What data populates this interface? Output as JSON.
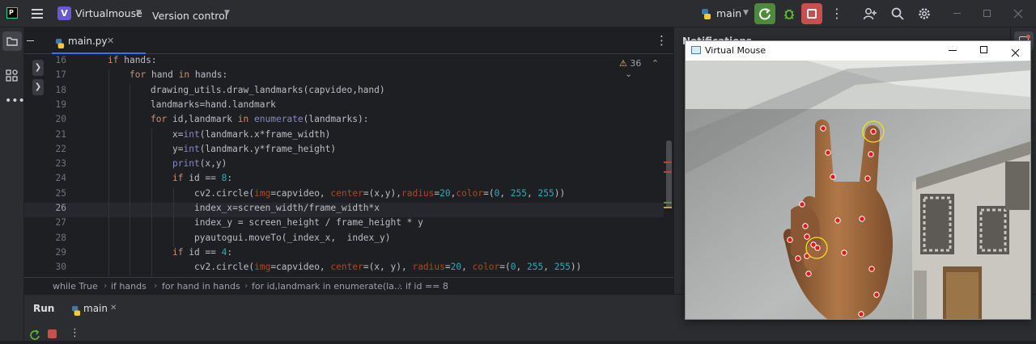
{
  "titlebar": {
    "project_badge": "V",
    "project_name": "Virtualmouse",
    "vcs_label": "Version control",
    "run_config": "main",
    "colors": {
      "badge": "#6b57d2",
      "rerun": "#4e8a3e",
      "stop": "#c94f4f"
    }
  },
  "editor": {
    "tab_label": "main.py",
    "warnings_count": "36",
    "lines": [
      {
        "n": "16",
        "code": "if hands:"
      },
      {
        "n": "17",
        "code": "for hand in hands:"
      },
      {
        "n": "18",
        "code": "drawing_utils.draw_landmarks(capvideo,hand)"
      },
      {
        "n": "19",
        "code": "landmarks=hand.landmark"
      },
      {
        "n": "20",
        "code": "for id,landmark in enumerate(landmarks):"
      },
      {
        "n": "21",
        "code": "x=int(landmark.x*frame_width)"
      },
      {
        "n": "22",
        "code": "y=int(landmark.y*frame_height)"
      },
      {
        "n": "23",
        "code": "print(x,y)"
      },
      {
        "n": "24",
        "code": "if id == 8:"
      },
      {
        "n": "25",
        "code": "cv2.circle(img=capvideo, center=(x,y),radius=20,color=(0, 255, 255))"
      },
      {
        "n": "26",
        "code": "index_x=screen_width/frame_width*x"
      },
      {
        "n": "27",
        "code": "index_y = screen_height / frame_height * y"
      },
      {
        "n": "28",
        "code": "pyautogui.moveTo(_index_x,  index_y)"
      },
      {
        "n": "29",
        "code": "if id == 4:"
      },
      {
        "n": "30",
        "code": "cv2.circle(img=capvideo, center=(x, y), radius=20, color=(0, 255, 255))"
      }
    ],
    "breadcrumb": [
      "while True",
      "if hands",
      "for hand in hands",
      "for id,landmark in enumerate(la...",
      "if id == 8"
    ]
  },
  "run_panel": {
    "title": "Run",
    "tab_label": "main"
  },
  "notifications_label": "Notifications",
  "virtual_mouse_window": {
    "title": "Virtual Mouse"
  },
  "icons": {
    "app": "pycharm-icon",
    "menu": "hamburger-icon",
    "python": "python-icon",
    "rerun": "rerun-icon",
    "debug": "debug-icon",
    "stop": "stop-icon",
    "more": "more-vert-icon",
    "add_user": "add-user-icon",
    "search": "search-icon",
    "settings": "gear-icon",
    "minimize": "minimize-icon",
    "maximize": "maximize-icon",
    "close": "close-icon",
    "project": "folder-icon",
    "structure": "structure-icon",
    "warning": "warning-icon"
  }
}
